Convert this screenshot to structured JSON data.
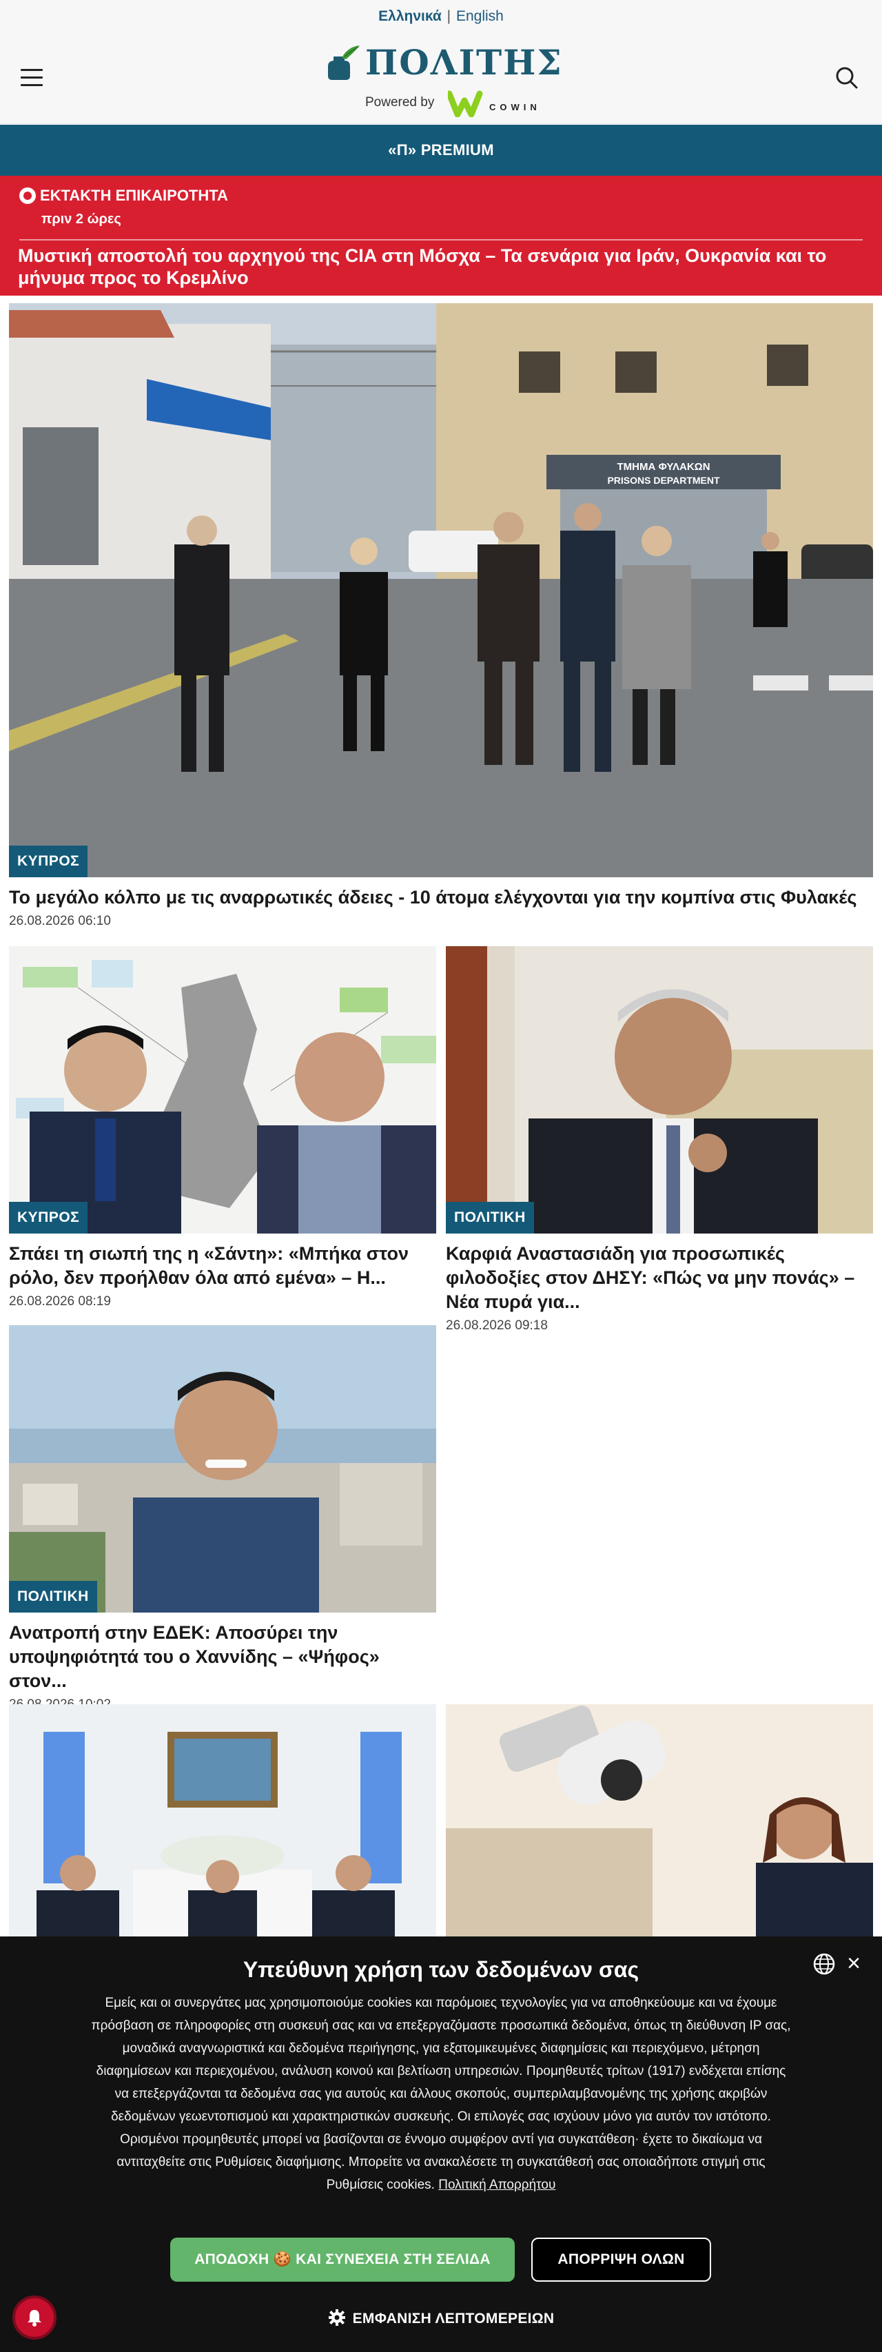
{
  "header": {
    "lang_active": "Ελληνικά",
    "lang_separator": "|",
    "lang_other": "English",
    "logo_text": "ΠΟΛΙΤΗΣ",
    "powered_by": "Powered by",
    "partner_logo_text": "COWIN"
  },
  "premium": {
    "label": "«Π» PREMIUM"
  },
  "breaking": {
    "tag": "ΕΚΤΑΚΤΗ ΕΠΙΚΑΙΡΟΤΗΤΑ",
    "time": "πριν 2 ώρες",
    "title": "Μυστική αποστολή του αρχηγού της CIA στη Μόσχα – Τα σενάρια για Ιράν, Ουκρανία και το μήνυμα προς το Κρεμλίνο"
  },
  "articles": [
    {
      "category": "ΚΥΠΡΟΣ",
      "title": "Το μεγάλο κόλπο με τις αναρρωτικές άδειες - 10 άτομα ελέγχονται για την κομπίνα στις Φυλακές",
      "date": "26.08.2026 06:10",
      "sign_gr": "ΤΜΗΜΑ ΦΥΛΑΚΩΝ",
      "sign_en": "PRISONS DEPARTMENT"
    },
    {
      "category": "ΚΥΠΡΟΣ",
      "title": "Σπάει τη σιωπή της η «Σάντη»: «Μπήκα στον ρόλο, δεν προήλθαν όλα από εμένα» – Η...",
      "date": "26.08.2026 08:19"
    },
    {
      "category": "ΠΟΛΙΤΙΚΗ",
      "title": "Καρφιά Αναστασιάδη για προσωπικές φιλοδοξίες στον ΔΗΣΥ: «Πώς να μην πονάς» – Νέα πυρά για...",
      "date": "26.08.2026 09:18"
    },
    {
      "category": "ΠΟΛΙΤΙΚΗ",
      "title": "Ανατροπή στην ΕΔΕΚ: Αποσύρει την υποψηφιότητά του ο Χαννίδης – «Ψήφος» στον...",
      "date": "26.08.2026 10:02"
    }
  ],
  "cookie": {
    "title": "Υπεύθυνη χρήση των δεδομένων σας",
    "text": "Εμείς και οι συνεργάτες μας χρησιμοποιούμε cookies και παρόμοιες τεχνολογίες για να αποθηκεύουμε και να έχουμε πρόσβαση σε πληροφορίες στη συσκευή σας και να επεξεργαζόμαστε προσωπικά δεδομένα, όπως τη διεύθυνση IP σας, μοναδικά αναγνωριστικά και δεδομένα περιήγησης, για εξατομικευμένες διαφημίσεις και περιεχόμενο, μέτρηση διαφημίσεων και περιεχομένου, ανάλυση κοινού και βελτίωση υπηρεσιών. Προμηθευτές τρίτων (1917) ενδέχεται επίσης να επεξεργάζονται τα δεδομένα σας για αυτούς και άλλους σκοπούς, συμπεριλαμβανομένης της χρήσης ακριβών δεδομένων γεωεντοπισμού και χαρακτηριστικών συσκευής. Οι επιλογές σας ισχύουν μόνο για αυτόν τον ιστότοπο. Ορισμένοι προμηθευτές μπορεί να βασίζονται σε έννομο συμφέρον αντί για συγκατάθεση· έχετε το δικαίωμα να αντιταχθείτε στις Ρυθμίσεις διαφήμισης. Μπορείτε να ανακαλέσετε τη συγκατάθεσή σας οποιαδήποτε στιγμή στις Ρυθμίσεις cookies.",
    "policy_link": "Πολιτική Απορρήτου",
    "accept_label": "ΑΠΟΔΟΧΗ 🍪 ΚΑΙ ΣΥΝΕΧΕΙΑ ΣΤΗ ΣΕΛΙΔΑ",
    "reject_label": "ΑΠΟΡΡΙΨΗ ΟΛΩΝ",
    "details_label": "ΕΜΦΑΝΙΣΗ ΛΕΠΤΟΜΕΡΕΙΩΝ"
  },
  "colors": {
    "brand_blue": "#145a78",
    "breaking_red": "#d81f30",
    "accept_green": "#62b56a",
    "cookie_bg": "#121212"
  }
}
